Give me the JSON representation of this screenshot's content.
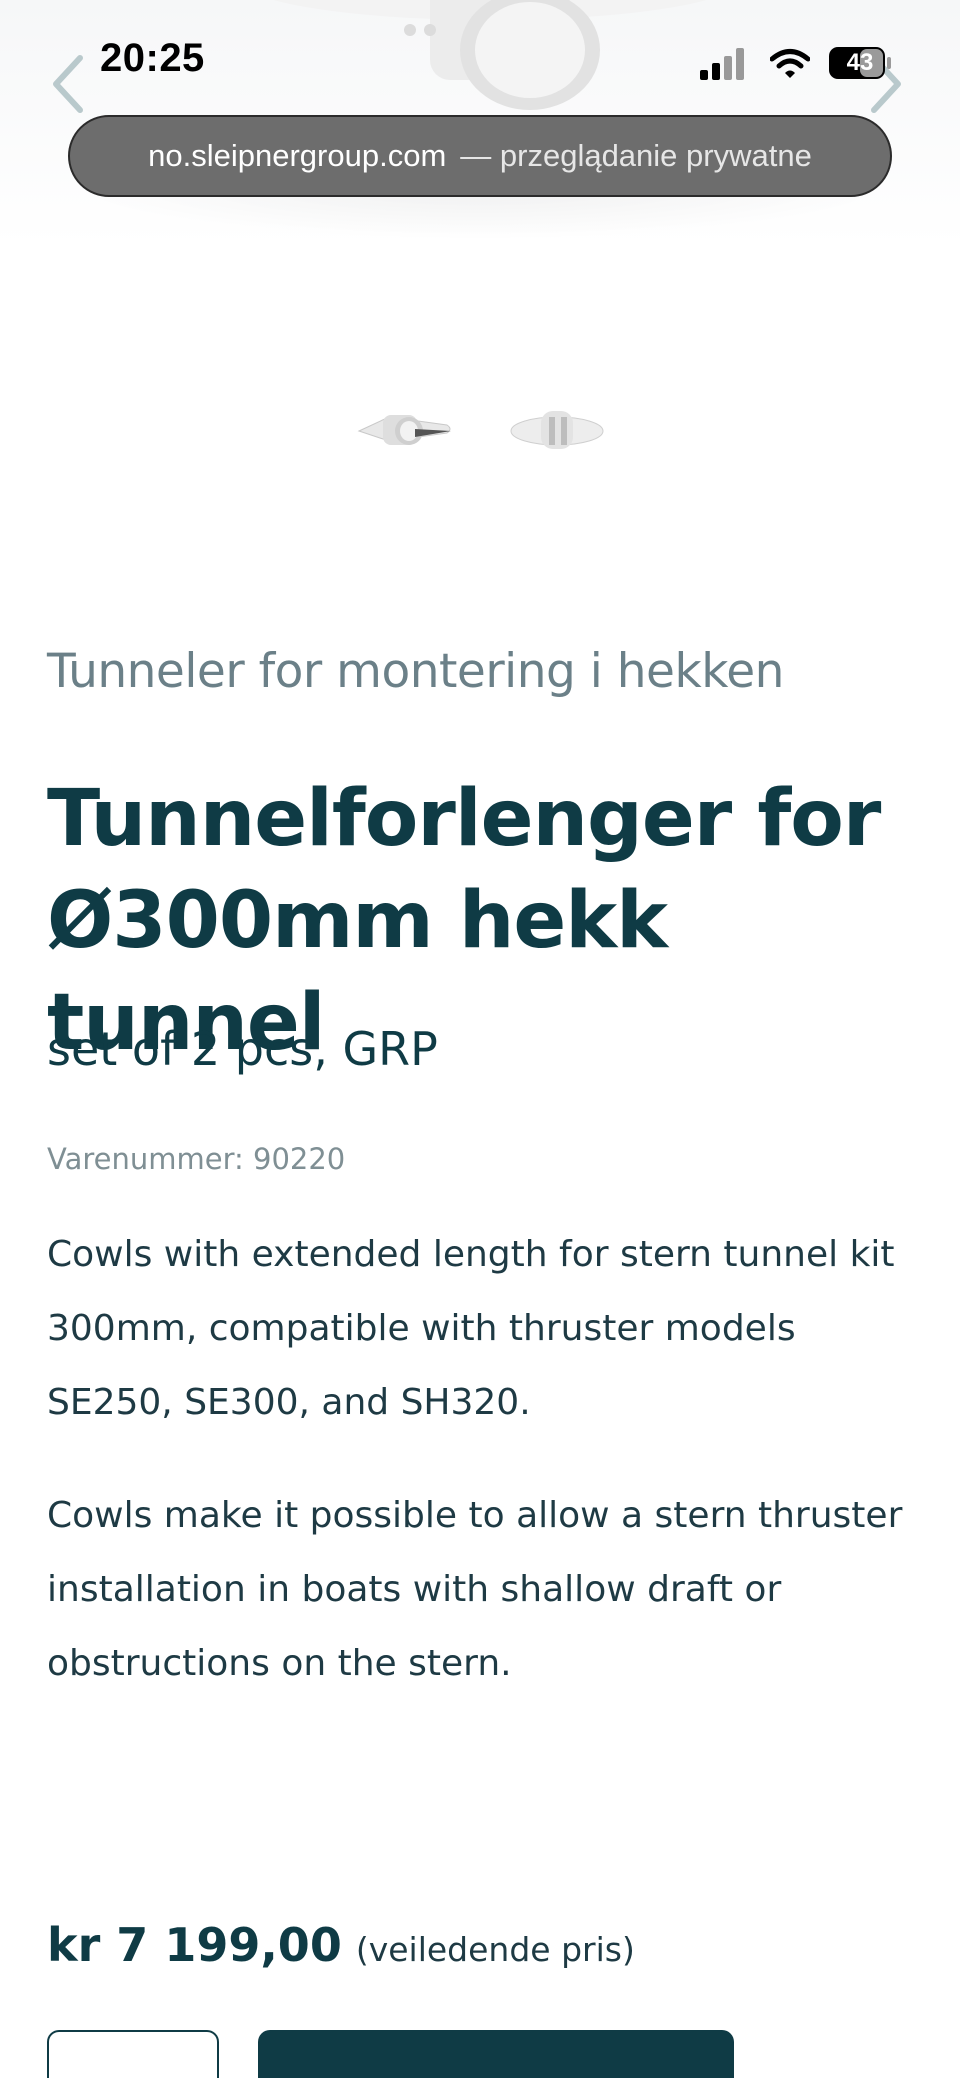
{
  "status_bar": {
    "time": "20:25",
    "battery": "43"
  },
  "address_bar": {
    "domain": "no.sleipnergroup.com",
    "mode": "— przeglądanie prywatne"
  },
  "product": {
    "category": "Tunneler for montering i hekken",
    "title": "Tunnelforlenger for Ø300mm hekk tunnel",
    "subtitle": "set of 2 pcs, GRP",
    "sku": "Varenummer: 90220",
    "description": [
      "Cowls with extended length for stern tunnel kit 300mm, compatible with thruster models SE250, SE300, and SH320.",
      "Cowls make it possible to allow a stern thruster installation in boats with shallow draft or obstructions on the stern."
    ],
    "price": "kr 7 199,00",
    "price_note": "(veiledende pris)"
  },
  "colors": {
    "brand": "#0f3b45",
    "muted": "#6b8088"
  },
  "icons": {
    "prev": "chevron-left-icon",
    "next": "chevron-right-icon",
    "signal": "cellular-signal-icon",
    "wifi": "wifi-icon",
    "battery": "battery-icon"
  }
}
